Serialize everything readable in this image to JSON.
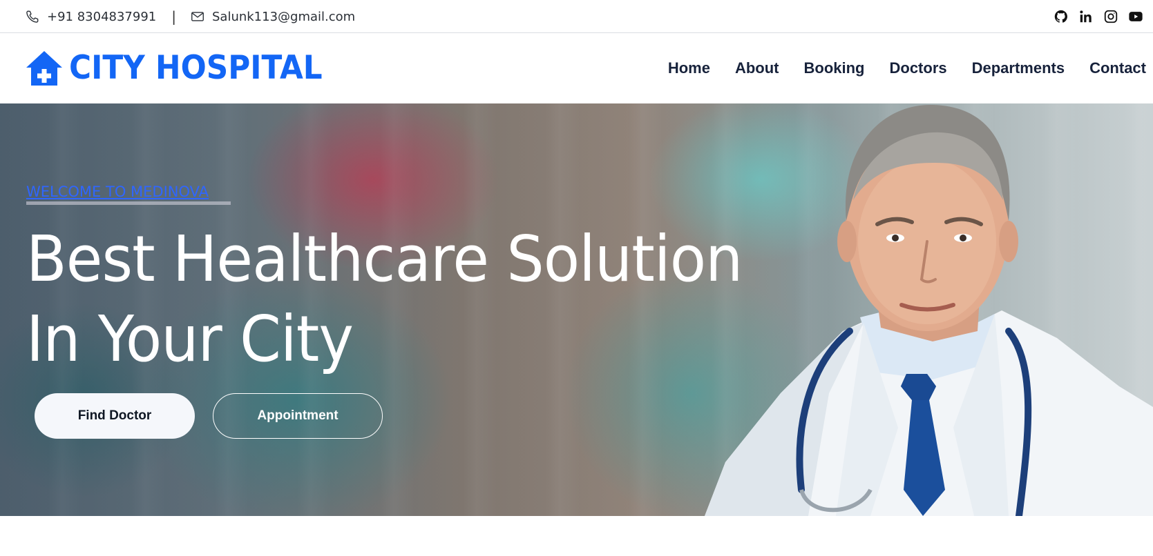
{
  "topbar": {
    "phone": "+91 8304837991",
    "separator": "|",
    "email": "Salunk113@gmail.com",
    "socials": [
      "github-icon",
      "linkedin-icon",
      "instagram-icon",
      "youtube-icon"
    ]
  },
  "brand": {
    "name": "CITY HOSPITAL",
    "icon": "hospital-home-icon",
    "color": "#1366f5"
  },
  "nav": {
    "items": [
      "Home",
      "About",
      "Booking",
      "Doctors",
      "Departments",
      "Contact"
    ]
  },
  "hero": {
    "kicker": "WELCOME TO MEDINOVA",
    "headline_line1": "Best Healthcare Solution",
    "headline_line2": "In Your City",
    "primary_button": "Find Doctor",
    "secondary_button": "Appointment"
  }
}
